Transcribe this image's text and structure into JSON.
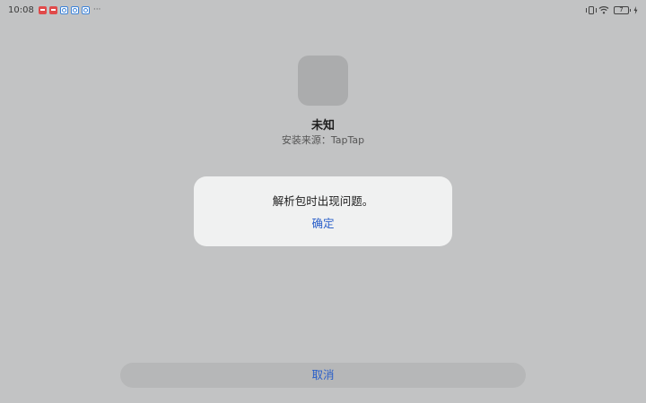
{
  "status_bar": {
    "time": "10:08",
    "more": "···",
    "battery_level": "7",
    "notification_icons": [
      "app-notification-red",
      "app-notification-red",
      "app-notification-blue",
      "app-notification-blue",
      "app-notification-blue"
    ]
  },
  "app": {
    "name": "未知",
    "install_source": "安装来源：TapTap"
  },
  "dialog": {
    "message": "解析包时出现问题。",
    "confirm_label": "确定"
  },
  "footer": {
    "cancel_label": "取消"
  },
  "colors": {
    "background": "#c2c3c4",
    "dialog_bg": "#f0f1f1",
    "accent": "#2a5fc9",
    "cancel_bg": "#b6b7b8"
  }
}
